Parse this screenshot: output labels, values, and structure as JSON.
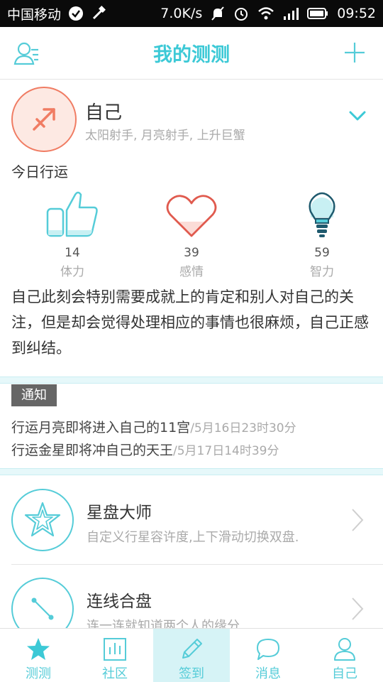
{
  "status_bar": {
    "carrier": "中国移动",
    "speed": "7.0K/s",
    "time": "09:52"
  },
  "header": {
    "title": "我的测测"
  },
  "profile": {
    "name": "自己",
    "signs": "太阳射手, 月亮射手, 上升巨蟹",
    "today_label": "今日行运",
    "stats": [
      {
        "value": "14",
        "label": "体力"
      },
      {
        "value": "39",
        "label": "感情"
      },
      {
        "value": "59",
        "label": "智力"
      }
    ],
    "description": "自己此刻会特别需要成就上的肯定和别人对自己的关注，但是却会觉得处理相应的事情也很麻烦，自己正感到纠结。"
  },
  "notice": {
    "tag": "通知",
    "items": [
      {
        "text": "行运月亮即将进入自己的11宫",
        "time": "/5月16日23时30分"
      },
      {
        "text": "行运金星即将冲自己的天王",
        "time": "/5月17日14时39分"
      }
    ]
  },
  "features": [
    {
      "title": "星盘大师",
      "subtitle": "自定义行星容许度,上下滑动切换双盘."
    },
    {
      "title": "连线合盘",
      "subtitle": "连一连就知道两个人的缘分."
    }
  ],
  "bottom_nav": [
    {
      "label": "测测"
    },
    {
      "label": "社区"
    },
    {
      "label": "签到"
    },
    {
      "label": "消息"
    },
    {
      "label": "自己"
    }
  ],
  "colors": {
    "accent": "#3cc9d6",
    "avatar_border": "#f07c63",
    "heart": "#e05a4e"
  }
}
